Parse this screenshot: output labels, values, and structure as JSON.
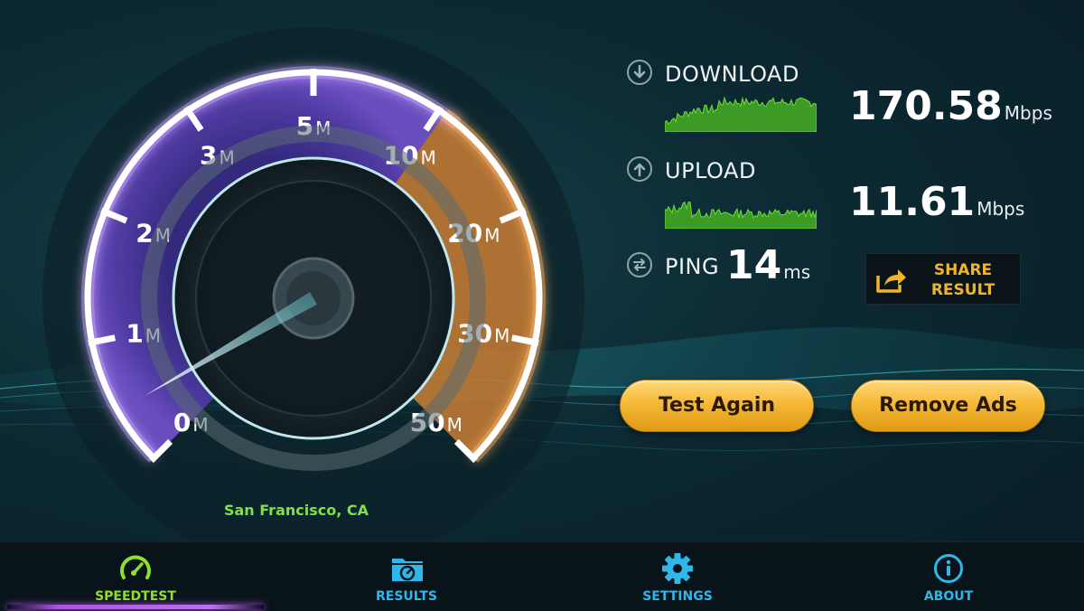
{
  "gauge": {
    "tick_labels": [
      {
        "num": "0",
        "unit": "M"
      },
      {
        "num": "1",
        "unit": "M"
      },
      {
        "num": "2",
        "unit": "M"
      },
      {
        "num": "3",
        "unit": "M"
      },
      {
        "num": "5",
        "unit": "M"
      },
      {
        "num": "10",
        "unit": "M"
      },
      {
        "num": "20",
        "unit": "M"
      },
      {
        "num": "30",
        "unit": "M"
      },
      {
        "num": "50",
        "unit": "M"
      }
    ],
    "needle_value_mbps": 0,
    "colors": {
      "arc": "#ffffff",
      "fill_low": "#5b3bb5",
      "fill_high": "#e38a34",
      "glow": "#a56cff"
    }
  },
  "location": "San Francisco, CA",
  "download": {
    "label": "DOWNLOAD",
    "value": "170.58",
    "unit": "Mbps",
    "icon": "arrow-down-circle-icon"
  },
  "upload": {
    "label": "UPLOAD",
    "value": "11.61",
    "unit": "Mbps",
    "icon": "arrow-up-circle-icon"
  },
  "ping": {
    "label": "PING",
    "value": "14",
    "unit": "ms",
    "icon": "swap-arrows-circle-icon"
  },
  "share": {
    "label_line1": "SHARE",
    "label_line2": "RESULT",
    "icon": "share-arrow-icon",
    "color": "#f2b52a"
  },
  "buttons": {
    "test_again": "Test Again",
    "remove_ads": "Remove Ads"
  },
  "tabs": [
    {
      "label": "SPEEDTEST",
      "icon": "speedometer-icon",
      "active": true
    },
    {
      "label": "RESULTS",
      "icon": "folder-gauge-icon",
      "active": false
    },
    {
      "label": "SETTINGS",
      "icon": "gear-icon",
      "active": false
    },
    {
      "label": "ABOUT",
      "icon": "info-icon",
      "active": false
    }
  ],
  "colors": {
    "accent_blue": "#2fb7ea",
    "accent_green": "#8fe02e",
    "button_gold": "#f5b935",
    "graph_green": "#58c22c"
  }
}
